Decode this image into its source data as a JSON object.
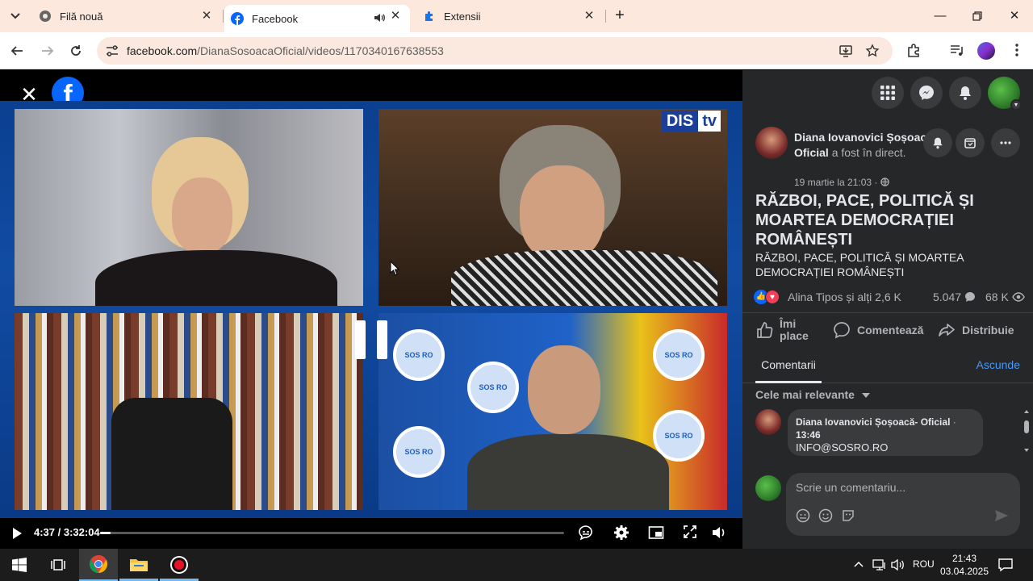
{
  "browser": {
    "tabs": [
      {
        "title": "Filă nouă",
        "icon": "chrome-icon"
      },
      {
        "title": "Facebook",
        "icon": "facebook-icon",
        "active": true,
        "audio": true
      },
      {
        "title": "Extensii",
        "icon": "puzzle-icon"
      }
    ],
    "url_host": "facebook.com",
    "url_path": "/DianaSosoacaOficial/videos/1170340167638553"
  },
  "video": {
    "overlay_logo": "DIS",
    "overlay_logo_tv": "tv",
    "sos_label": "SOS RO",
    "time_current": "4:37",
    "time_total": "3:32:04",
    "time_display": "4:37 / 3:32:04",
    "progress_fraction": 0.022
  },
  "post": {
    "page_name": "Diana Iovanovici Șoșoacă- Oficial",
    "live_suffix": "a fost în direct.",
    "date": "19 martie la 21:03 · ",
    "title": "RĂZBOI, PACE, POLITICĂ ȘI MOARTEA DEMOCRAȚIEI ROMÂNEȘTI",
    "description": "RĂZBOI, PACE, POLITICĂ ȘI MOARTEA DEMOCRAȚIEI ROMÂNEȘTI",
    "reactions_text": "Alina Tipos și alți 2,6 K",
    "comments_count": "5.047",
    "views_count": "68 K"
  },
  "actions": {
    "like": "Îmi place",
    "comment": "Comentează",
    "share": "Distribuie"
  },
  "comments": {
    "tab_label": "Comentarii",
    "hide_label": "Ascunde",
    "sort_label": "Cele mai relevante",
    "items": [
      {
        "author": "Diana Iovanovici Șoșoacă- Oficial",
        "sep": " · ",
        "time": "13:46",
        "text": "INFO@SOSRO.RO"
      }
    ],
    "write_placeholder": "Scrie un comentariu..."
  },
  "taskbar": {
    "language": "ROU",
    "time": "21:43",
    "date": "03.04.2025"
  },
  "colors": {
    "fb_blue": "#0866ff",
    "panel_bg": "#252728",
    "tabbar_bg": "#fce8dc",
    "link_blue": "#4599ff"
  }
}
